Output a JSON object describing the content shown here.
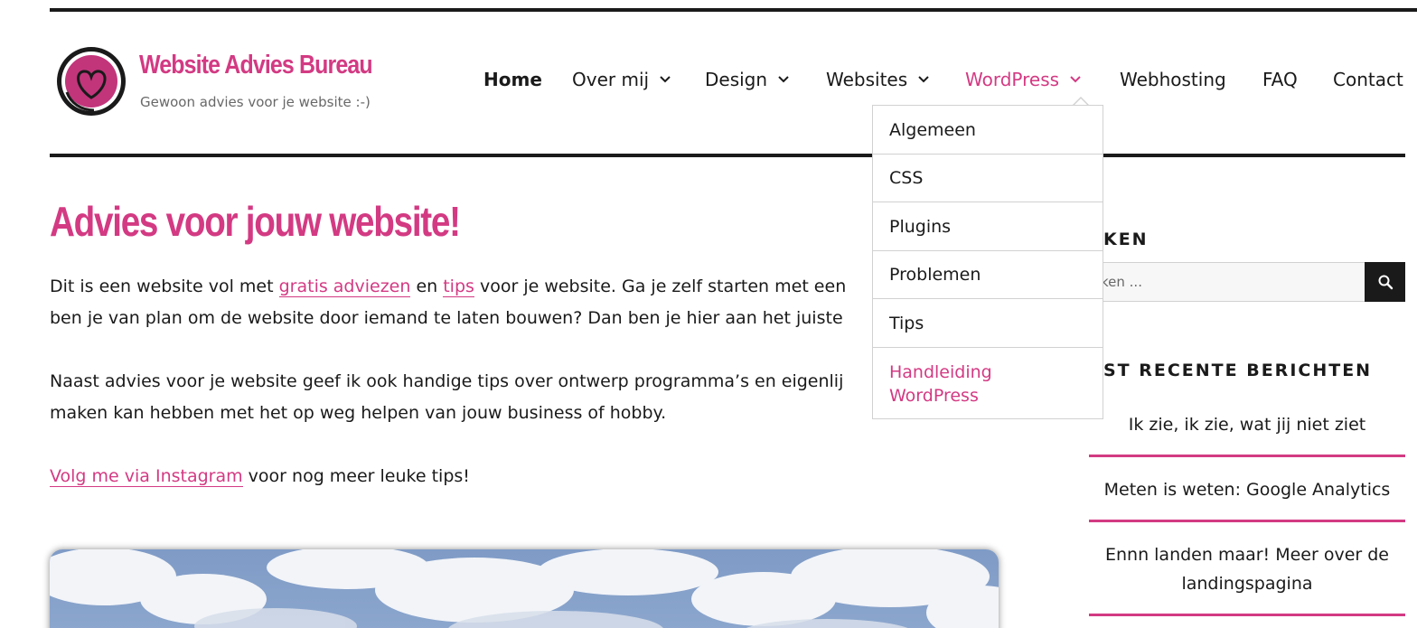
{
  "site": {
    "title": "Website Advies Bureau",
    "description": "Gewoon advies voor je website :-)",
    "logo_icon": "heart-swirl-logo"
  },
  "nav": {
    "items": [
      {
        "label": "Home",
        "has_submenu": false,
        "current": true
      },
      {
        "label": "Over mij",
        "has_submenu": true
      },
      {
        "label": "Design",
        "has_submenu": true
      },
      {
        "label": "Websites",
        "has_submenu": true
      },
      {
        "label": "WordPress",
        "has_submenu": true,
        "open": true
      },
      {
        "label": "Webhosting",
        "has_submenu": false
      },
      {
        "label": "FAQ",
        "has_submenu": false
      },
      {
        "label": "Contact",
        "has_submenu": false
      }
    ],
    "submenu_wordpress": [
      {
        "label": "Algemeen"
      },
      {
        "label": "CSS"
      },
      {
        "label": "Plugins"
      },
      {
        "label": "Problemen"
      },
      {
        "label": "Tips"
      },
      {
        "label_line1": "Handleiding",
        "label_line2": "WordPress"
      }
    ]
  },
  "main": {
    "title": "Advies voor jouw website!",
    "p1_line1_a": "Dit is een website vol met ",
    "p1_link1": "gratis adviezen",
    "p1_line1_b": " en ",
    "p1_link2": "tips",
    "p1_line1_c": " voor je website. Ga je zelf starten met een",
    "p1_line2": "ben je van plan om de website door iemand te laten bouwen? Dan ben je hier aan het juiste",
    "p2_line1": "Naast advies voor je website geef ik ook handige tips over ontwerp programma’s en eigenlij",
    "p2_line2": "maken kan hebben met het op weg helpen van jouw business of hobby.",
    "p3_link": "Volg me via Instagram",
    "p3_rest": " voor nog meer leuke tips!"
  },
  "sidebar": {
    "search_title": "EKEN",
    "search_placeholder": "ken ...",
    "recent_title": "EST RECENTE BERICHTEN",
    "recent_posts": [
      {
        "line1": "Ik zie, ik zie, wat jij niet ziet"
      },
      {
        "line1": "Meten is weten: Google Analytics"
      },
      {
        "line1": "Ennn landen maar! Meer over de",
        "line2": "landingspagina"
      }
    ]
  },
  "colors": {
    "accent": "#d33a83",
    "text": "#1a1a1a",
    "muted": "#686868",
    "border": "#d1d1d1"
  }
}
